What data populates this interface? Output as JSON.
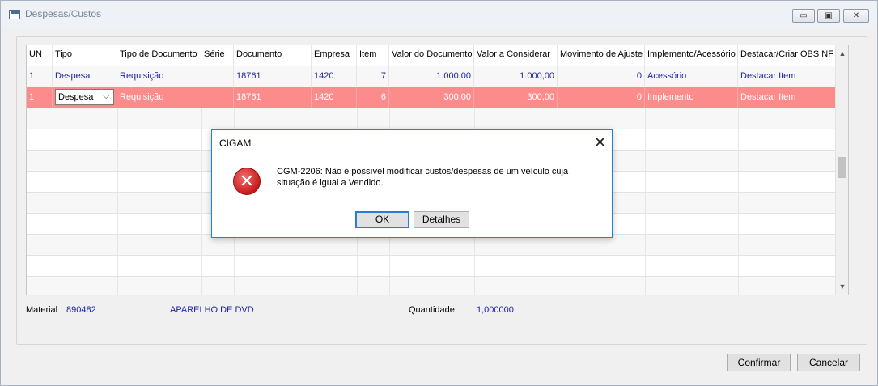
{
  "window": {
    "title": "Despesas/Custos",
    "controls": {
      "minimize": "▭",
      "maximize": "▣",
      "close": "✕"
    }
  },
  "grid": {
    "columns": [
      "UN",
      "Tipo",
      "Tipo de Documento",
      "Série",
      "Documento",
      "Empresa",
      "Item",
      "Valor do Documento",
      "Valor a Considerar",
      "Movimento de Ajuste",
      "Implemento/Acessório",
      "Destacar/Criar OBS NF"
    ],
    "rows": [
      [
        "1",
        "Despesa",
        "Requisição",
        "",
        "18761",
        "1420",
        "7",
        "1.000,00",
        "1.000,00",
        "0",
        "Acessório",
        "Destacar Item"
      ],
      [
        "1",
        "Despesa",
        "Requisição",
        "",
        "18761",
        "1420",
        "6",
        "300,00",
        "300,00",
        "0",
        "Implemento",
        "Destacar Item"
      ]
    ],
    "combo_arrow": "⌵"
  },
  "footer": {
    "material_label": "Material",
    "material_code": "890482",
    "material_desc": "APARELHO DE DVD",
    "quantidade_label": "Quantidade",
    "quantidade_value": "1,000000"
  },
  "buttons": {
    "confirm": "Confirmar",
    "cancel": "Cancelar"
  },
  "dialog": {
    "title": "CIGAM",
    "close": "✕",
    "icon_glyph": "✕",
    "message": "CGM-2206: Não é possível modificar custos/despesas de um veículo cuja situação é igual a Vendido.",
    "ok": "OK",
    "details": "Detalhes"
  },
  "colors": {
    "selected_row": "#fc8c8c",
    "link_text": "#1f24a8",
    "dialog_border": "#1a84d6"
  }
}
